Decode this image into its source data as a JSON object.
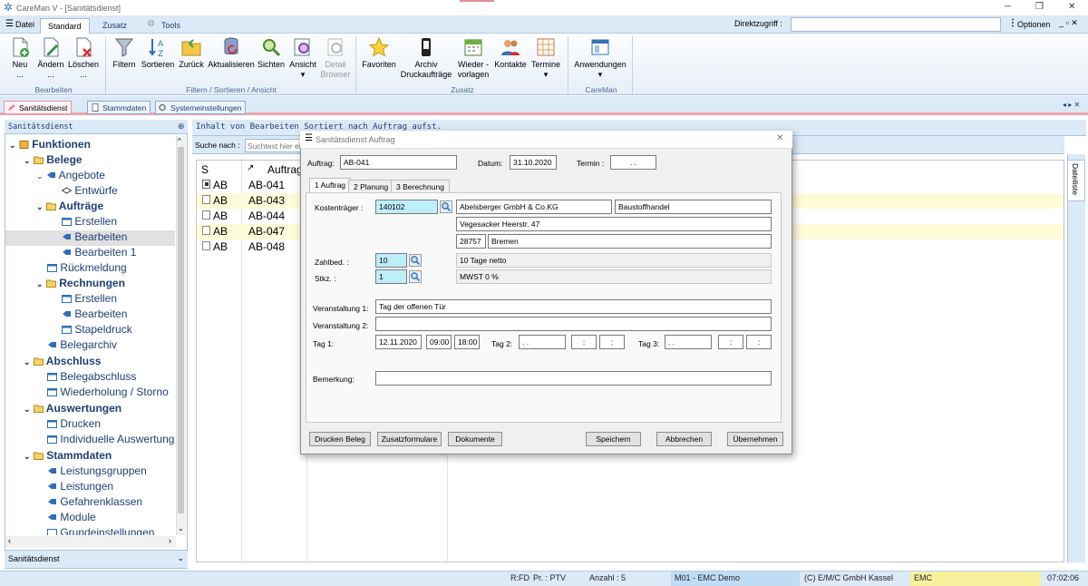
{
  "app": {
    "title": "CareMan V - [Sanitätsdienst]"
  },
  "menu": {
    "datei": "Datei",
    "tabs": [
      "Standard",
      "Zusatz",
      "Tools"
    ],
    "direktzugriff": "Direktzugriff :",
    "optionen": "Optionen"
  },
  "ribbon": {
    "buttons": [
      "Neu",
      "Ändern",
      "Löschen",
      "Filtern",
      "Sortieren",
      "Zurück",
      "Aktualisieren",
      "Sichten",
      "Ansicht",
      "Detail",
      "Favoriten",
      "Archiv",
      "Wieder -",
      "Kontakte",
      "Termine",
      "Anwendungen"
    ],
    "subs": {
      "neu": "...",
      "aendern": "...",
      "loeschen": "...",
      "detail": "Browser",
      "archiv": "Druckaufträge",
      "wieder": "vorlagen"
    },
    "groups": [
      "Bearbeiten",
      "Filtern / Sortieren / Ansicht",
      "Zusatz",
      "CareMan"
    ]
  },
  "doc_tabs": [
    "Sanitätsdienst",
    "Stammdaten",
    "Systemeinstellungen"
  ],
  "left_panel": {
    "header": "Sanitätsdienst",
    "footer": "Sanitätsdienst",
    "tree": [
      "Funktionen",
      "Belege",
      "Angebote",
      "Entwürfe",
      "Aufträge",
      "Erstellen",
      "Bearbeiten",
      "Bearbeiten 1",
      "Rückmeldung",
      "Rechnungen",
      "Erstellen",
      "Bearbeiten",
      "Stapeldruck",
      "Belegarchiv",
      "Abschluss",
      "Belegabschluss",
      "Wiederholung / Storno",
      "Auswertungen",
      "Drucken",
      "Individuelle Auswertung",
      "Stammdaten",
      "Leistungsgruppen",
      "Leistungen",
      "Gefahrenklassen",
      "Module",
      "Grundeinstellungen"
    ]
  },
  "main": {
    "header": "Inhalt von Bearbeiten Sortiert nach Auftrag aufst.",
    "search_label": "Suche nach :",
    "search_placeholder": "Suchtext hier ei",
    "columns": [
      "S",
      "Auftrag"
    ],
    "rows": [
      {
        "s": "AB",
        "auftrag": "AB-041"
      },
      {
        "s": "AB",
        "auftrag": "AB-043"
      },
      {
        "s": "AB",
        "auftrag": "AB-044"
      },
      {
        "s": "AB",
        "auftrag": "AB-047"
      },
      {
        "s": "AB",
        "auftrag": "AB-048"
      }
    ],
    "sidebar_tab": "Dateiliste"
  },
  "dialog": {
    "title": "Sanitätsdienst Auftrag",
    "auftrag_label": "Auftrag:",
    "auftrag": "AB-041",
    "datum_label": "Datum:",
    "datum": "31.10.2020",
    "termin_label": "Termin :",
    "termin": ". .",
    "tabs": [
      "1 Auftrag",
      "2 Planung",
      "3 Berechnung"
    ],
    "kostentraeger_label": "Kostenträger :",
    "kostentraeger": "140102",
    "name": "Abelsberger GmbH & Co.KG",
    "branche": "Baustoffhandel",
    "strasse": "Vegesacker Heerstr. 47",
    "plz": "28757",
    "ort": "Bremen",
    "zahlbed_label": "Zahlbed. :",
    "zahlbed": "10",
    "zahlbed_text": "10 Tage netto",
    "stkz_label": "Stkz. :",
    "stkz": "1",
    "stkz_text": "MWST 0 %",
    "veranst1_label": "Veranstaltung 1:",
    "veranst1": "Tag der offenen Tür",
    "veranst2_label": "Veranstaltung 2:",
    "veranst2": "",
    "tag1_label": "Tag 1:",
    "tag1_date": "12.11.2020",
    "tag1_from": "09:00",
    "tag1_to": "18:00",
    "tag2_label": "Tag 2:",
    "tag2_date": ". .",
    "tag2_from": ":",
    "tag2_to": ":",
    "tag3_label": "Tag 3:",
    "tag3_date": ". .",
    "tag3_from": ":",
    "tag3_to": ":",
    "bemerkung_label": "Bemerkung:",
    "bemerkung": "",
    "buttons": [
      "Drucken Beleg",
      "Zusatzformulare",
      "Dokumente",
      "Speichern",
      "Abbrechen",
      "Übernehmen"
    ]
  },
  "status": {
    "rfd": "R:FD",
    "pr": "Pr. : PTV",
    "anzahl": "Anzahl : 5",
    "mandant": "M01 - EMC Demo",
    "copyright": "(C) E/M/C GmbH Kassel",
    "user": "EMC",
    "time": "07:02:06"
  },
  "colors": {
    "accent": "#dce9f7",
    "highlight_row": "#fefbd9",
    "input_cyan": "#bdeefa",
    "tab_pink": "#f0a2ad",
    "status_mandant": "#bfdcf5",
    "status_user": "#f7f19d"
  }
}
